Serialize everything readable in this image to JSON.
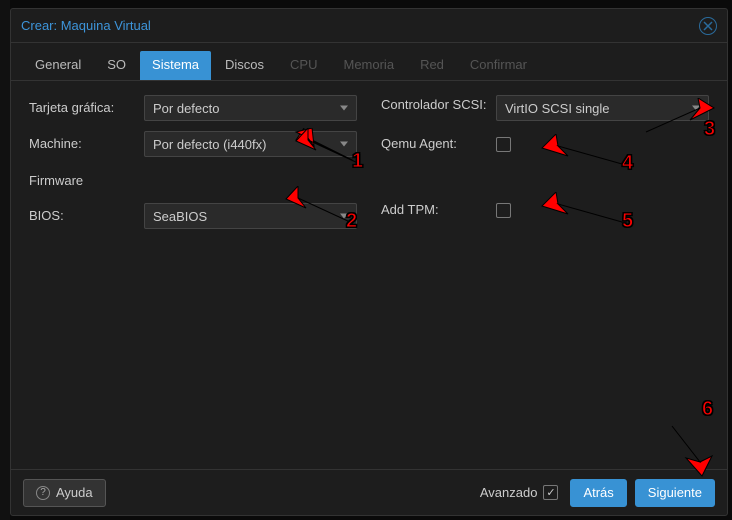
{
  "dialog": {
    "title": "Crear: Maquina Virtual"
  },
  "tabs": {
    "general": "General",
    "so": "SO",
    "sistema": "Sistema",
    "discos": "Discos",
    "cpu": "CPU",
    "memoria": "Memoria",
    "red": "Red",
    "confirmar": "Confirmar"
  },
  "labels": {
    "graphics": "Tarjeta gráfica:",
    "machine": "Machine:",
    "firmware": "Firmware",
    "bios": "BIOS:",
    "scsi": "Controlador SCSI:",
    "qemu": "Qemu Agent:",
    "tpm": "Add TPM:"
  },
  "values": {
    "graphics": "Por defecto",
    "machine": "Por defecto (i440fx)",
    "bios": "SeaBIOS",
    "scsi": "VirtIO SCSI single"
  },
  "footer": {
    "help": "Ayuda",
    "advanced": "Avanzado",
    "back": "Atrás",
    "next": "Siguiente"
  },
  "annotations": {
    "n1": "1",
    "n2": "2",
    "n3": "3",
    "n4": "4",
    "n5": "5",
    "n6": "6"
  }
}
